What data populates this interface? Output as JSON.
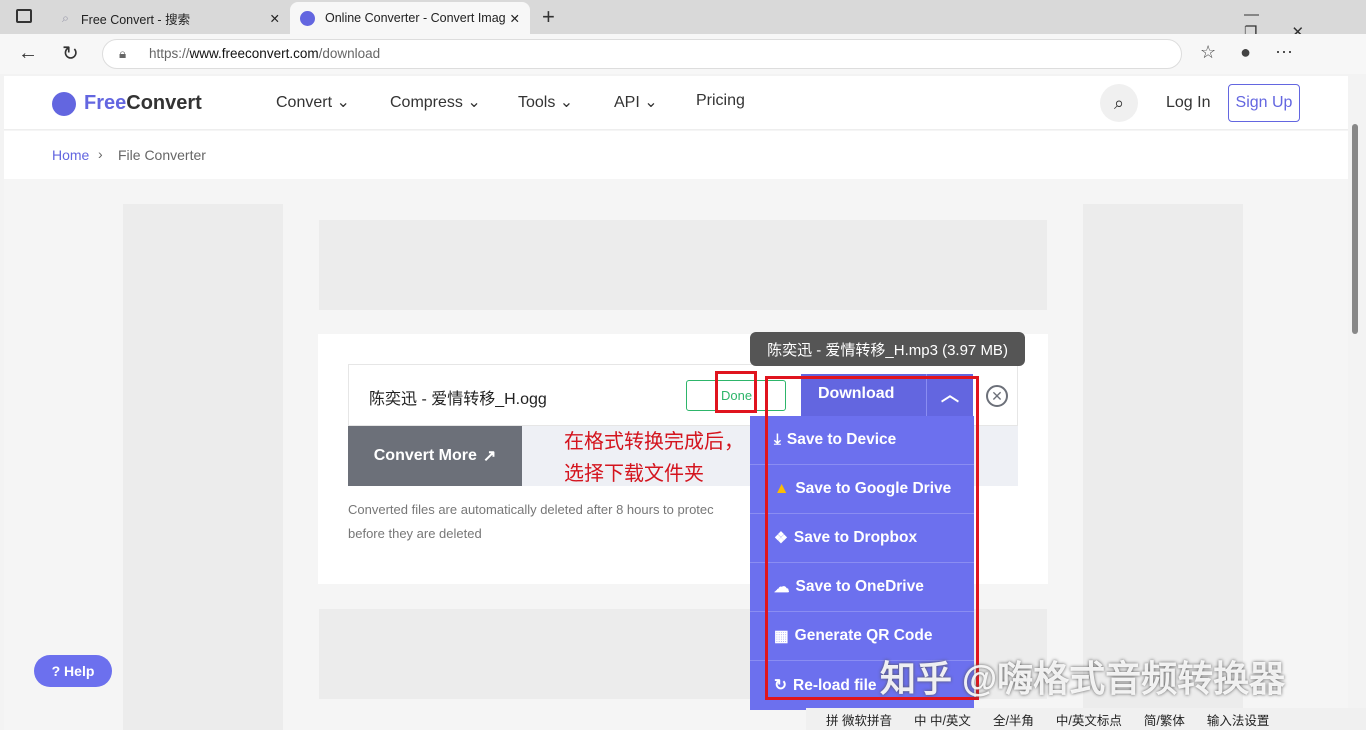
{
  "browser": {
    "tabs": [
      {
        "title": "Free Convert - 搜索"
      },
      {
        "title": "Online Converter - Convert Image"
      }
    ],
    "url_prefix": "https://",
    "url_host": "www.freeconvert.com",
    "url_path": "/download"
  },
  "site": {
    "logo_a": "Free",
    "logo_b": "Convert",
    "nav": [
      "Convert",
      "Compress",
      "Tools",
      "API",
      "Pricing"
    ],
    "login": "Log In",
    "signup": "Sign Up",
    "accent": "#6366e0"
  },
  "breadcrumb": {
    "home": "Home",
    "current": "File Converter"
  },
  "file": {
    "name": "陈奕迅 - 爱情转移_H.ogg",
    "status": "Done",
    "download": "Download",
    "tooltip": "陈奕迅 - 爱情转移_H.mp3 (3.97 MB)"
  },
  "convert_more": "Convert More",
  "note_line1": "Converted files are automatically deleted after 8 hours to protec",
  "note_line2": "before they are deleted",
  "menu": [
    "Save to Device",
    "Save to Google Drive",
    "Save to Dropbox",
    "Save to OneDrive",
    "Generate QR Code",
    "Re-load file"
  ],
  "annotation": [
    "在格式转换完成后，",
    "选择下载文件夹"
  ],
  "help": "Help",
  "watermark": "知乎 @嗨格式音频转换器",
  "ime": [
    "拼 微软拼音",
    "中 中/英文",
    "全/半角",
    "中/英文标点",
    "简/繁体",
    "输入法设置"
  ]
}
